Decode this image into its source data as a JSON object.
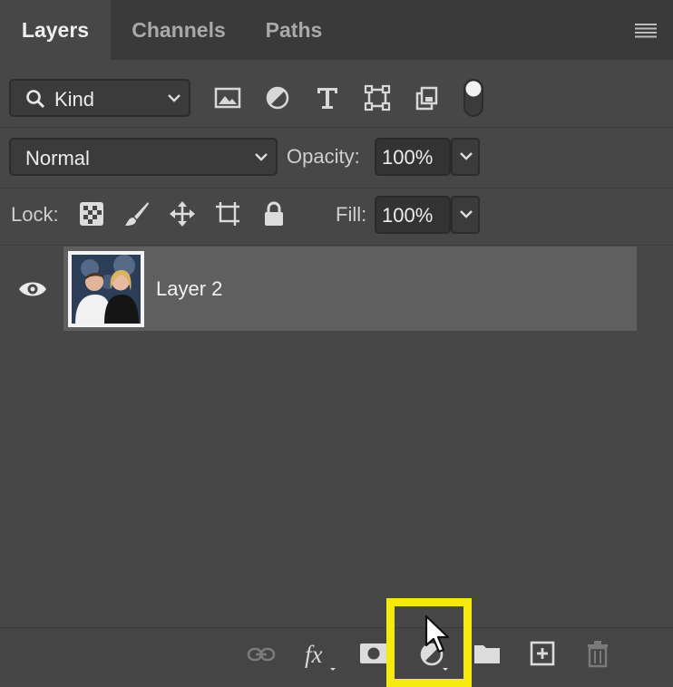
{
  "tabs": [
    {
      "label": "Layers",
      "active": true
    },
    {
      "label": "Channels",
      "active": false
    },
    {
      "label": "Paths",
      "active": false
    }
  ],
  "panel_menu_icon": "hamburger-menu-icon",
  "filter": {
    "kind_label": "Kind",
    "icons": [
      "image-filter-icon",
      "adjustment-filter-icon",
      "type-filter-icon",
      "shape-filter-icon",
      "smart-object-filter-icon",
      "filter-toggle-icon"
    ]
  },
  "blend": {
    "mode": "Normal",
    "opacity_label": "Opacity:",
    "opacity_value": "100%"
  },
  "lock": {
    "label": "Lock:",
    "icons": [
      "lock-transparent-pixels-icon",
      "lock-image-pixels-icon",
      "lock-position-icon",
      "lock-artboard-icon",
      "lock-all-icon"
    ],
    "fill_label": "Fill:",
    "fill_value": "100%"
  },
  "layers": [
    {
      "name": "Layer 2",
      "visible": true,
      "selected": true,
      "thumbnail": "photo of two people"
    }
  ],
  "bottom_icons": [
    "link-layers-icon",
    "fx-icon",
    "add-mask-icon",
    "adjustment-layer-icon",
    "new-group-icon",
    "new-layer-icon",
    "delete-layer-icon"
  ],
  "colors": {
    "panel_bg": "#474747",
    "selected_layer": "#5f5f5f",
    "highlight": "#f4ea10"
  }
}
